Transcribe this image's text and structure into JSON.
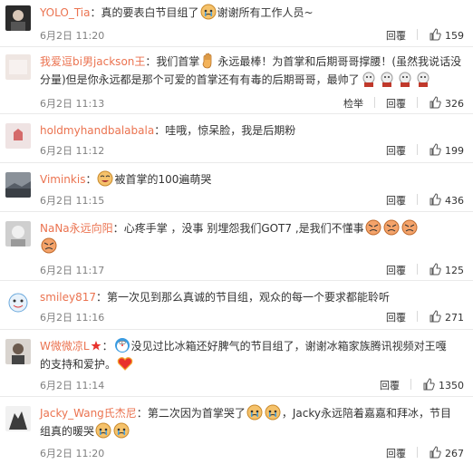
{
  "comments": [
    {
      "user": "YOLO_Tia",
      "sep": "：",
      "text": "真的要表白节目组了",
      "text2": "谢谢所有工作人员~",
      "time": "6月2日 11:20",
      "likes": "159"
    },
    {
      "user": "我爱逗bi男jackson王",
      "sep": "：",
      "text": "我们首掌",
      "text2": "永远最棒！为首掌和后期哥哥撑腰！(虽然我说话没",
      "line2": "分量)但是你永远都是那个可爱的首掌还有有毒的后期哥哥，最帅了",
      "time": "6月2日 11:13",
      "extra_action": "检举",
      "likes": "326"
    },
    {
      "user": "holdmyhandbalabala",
      "sep": "：",
      "text": "哇哦，惊呆脸，我是后期粉",
      "time": "6月2日 11:12",
      "likes": "199"
    },
    {
      "user": "Viminkis",
      "sep": "：",
      "text": "被首掌的100遍萌哭",
      "time": "6月2日 11:15",
      "likes": "436"
    },
    {
      "user": "NaNa永远向阳",
      "sep": "：",
      "text": "心疼手掌 ，没事 别埋怨我们GOT7 ,是我们不懂事",
      "time": "6月2日 11:17",
      "likes": "125"
    },
    {
      "user": "smiley817",
      "sep": "：",
      "text": "第一次见到那么真诚的节目组，观众的每一个要求都能聆听",
      "time": "6月2日 11:16",
      "likes": "271"
    },
    {
      "user": "W微微凉L",
      "sep": "：",
      "text": "没见过比冰箱还好脾气的节目组了，谢谢冰箱家族腾讯视频对王嘎",
      "line2": "的支持和爱护。",
      "time": "6月2日 11:14",
      "likes": "1350"
    },
    {
      "user": "Jacky_Wang氏杰尼",
      "sep": "：",
      "text": "第二次因为首掌哭了",
      "text2": "，Jacky永远陪着嘉嘉和拜冰，节目",
      "line2": "组真的暖哭",
      "time": "6月2日 11:20",
      "likes": "267"
    }
  ],
  "reply_label": "回覆",
  "colors": {
    "username": "#eb7350",
    "text": "#333333",
    "meta": "#808080",
    "divider": "#eaeaea"
  }
}
